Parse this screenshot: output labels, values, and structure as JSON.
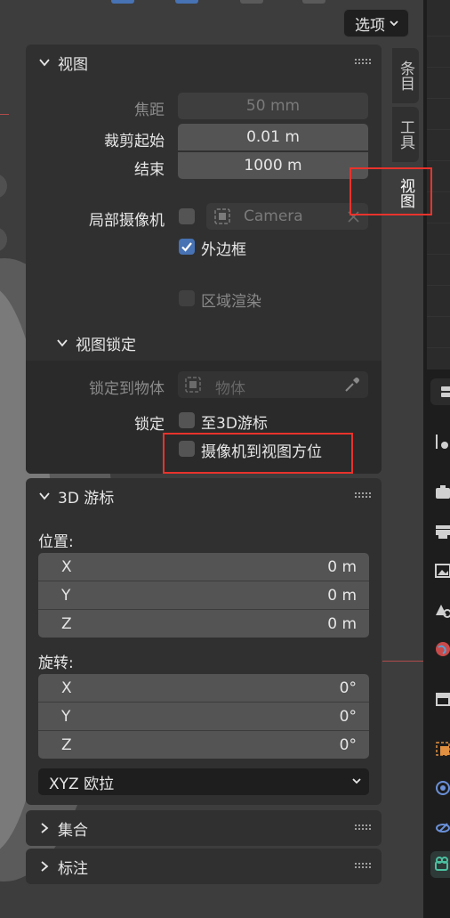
{
  "header": {
    "options_label": "选项"
  },
  "panels": {
    "view": {
      "title": "视图",
      "focal_length": {
        "label": "焦距",
        "value": "50 mm"
      },
      "clip_start": {
        "label": "裁剪起始",
        "value": "0.01 m"
      },
      "clip_end": {
        "label": "结束",
        "value": "1000 m"
      },
      "local_camera": {
        "label": "局部摄像机",
        "placeholder": "Camera"
      },
      "border": {
        "label": "外边框",
        "checked": true
      },
      "region_render": {
        "label": "区域渲染",
        "checked": false
      },
      "view_lock": {
        "title": "视图锁定",
        "lock_to_object": {
          "label": "锁定到物体",
          "placeholder": "物体"
        },
        "lock_label": "锁定",
        "to_3d_cursor": {
          "label": "至3D游标",
          "checked": false
        },
        "camera_to_view": {
          "label": "摄像机到视图方位",
          "checked": false
        }
      }
    },
    "cursor3d": {
      "title": "3D 游标",
      "location_label": "位置:",
      "location": [
        {
          "axis": "X",
          "value": "0 m"
        },
        {
          "axis": "Y",
          "value": "0 m"
        },
        {
          "axis": "Z",
          "value": "0 m"
        }
      ],
      "rotation_label": "旋转:",
      "rotation": [
        {
          "axis": "X",
          "value": "0°"
        },
        {
          "axis": "Y",
          "value": "0°"
        },
        {
          "axis": "Z",
          "value": "0°"
        }
      ],
      "rotation_mode": "XYZ 欧拉"
    },
    "collection": {
      "title": "集合"
    },
    "annotation": {
      "title": "标注"
    }
  },
  "side_tabs": [
    {
      "label": "条目",
      "active": false
    },
    {
      "label": "工具",
      "active": false
    },
    {
      "label": "视图",
      "active": true
    }
  ],
  "colors": {
    "accent": "#4772b3",
    "highlight": "#e8332c",
    "panel_bg": "#303030",
    "field_bg": "#545454"
  }
}
